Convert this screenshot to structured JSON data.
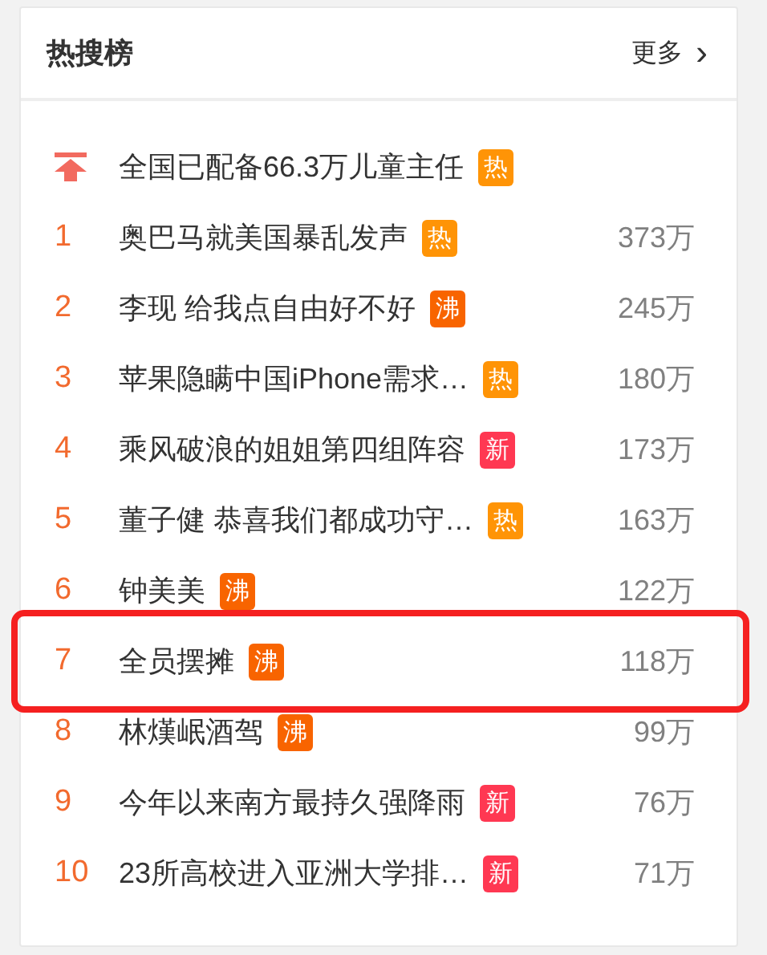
{
  "header": {
    "title": "热搜榜",
    "more": "更多",
    "more_icon": "›"
  },
  "pinned": {
    "title": "全国已配备66.3万儿童主任",
    "badge": {
      "label": "热",
      "kind": "hot"
    }
  },
  "items": [
    {
      "rank": "1",
      "title": "奥巴马就美国暴乱发声",
      "badge": {
        "label": "热",
        "kind": "hot"
      },
      "count": "373万",
      "highlighted": false
    },
    {
      "rank": "2",
      "title": "李现 给我点自由好不好",
      "badge": {
        "label": "沸",
        "kind": "boil"
      },
      "count": "245万",
      "highlighted": false
    },
    {
      "rank": "3",
      "title": "苹果隐瞒中国iPhone需求…",
      "badge": {
        "label": "热",
        "kind": "hot"
      },
      "count": "180万",
      "highlighted": false
    },
    {
      "rank": "4",
      "title": "乘风破浪的姐姐第四组阵容",
      "badge": {
        "label": "新",
        "kind": "new"
      },
      "count": "173万",
      "highlighted": false
    },
    {
      "rank": "5",
      "title": "董子健 恭喜我们都成功守…",
      "badge": {
        "label": "热",
        "kind": "hot"
      },
      "count": "163万",
      "highlighted": false
    },
    {
      "rank": "6",
      "title": "钟美美",
      "badge": {
        "label": "沸",
        "kind": "boil"
      },
      "count": "122万",
      "highlighted": false
    },
    {
      "rank": "7",
      "title": "全员摆摊",
      "badge": {
        "label": "沸",
        "kind": "boil"
      },
      "count": "118万",
      "highlighted": true
    },
    {
      "rank": "8",
      "title": "林熯岷酒驾",
      "badge": {
        "label": "沸",
        "kind": "boil"
      },
      "count": "99万",
      "highlighted": false
    },
    {
      "rank": "9",
      "title": "今年以来南方最持久强降雨",
      "badge": {
        "label": "新",
        "kind": "new"
      },
      "count": "76万",
      "highlighted": false
    },
    {
      "rank": "10",
      "title": "23所高校进入亚洲大学排…",
      "badge": {
        "label": "新",
        "kind": "new"
      },
      "count": "71万",
      "highlighted": false
    }
  ]
}
